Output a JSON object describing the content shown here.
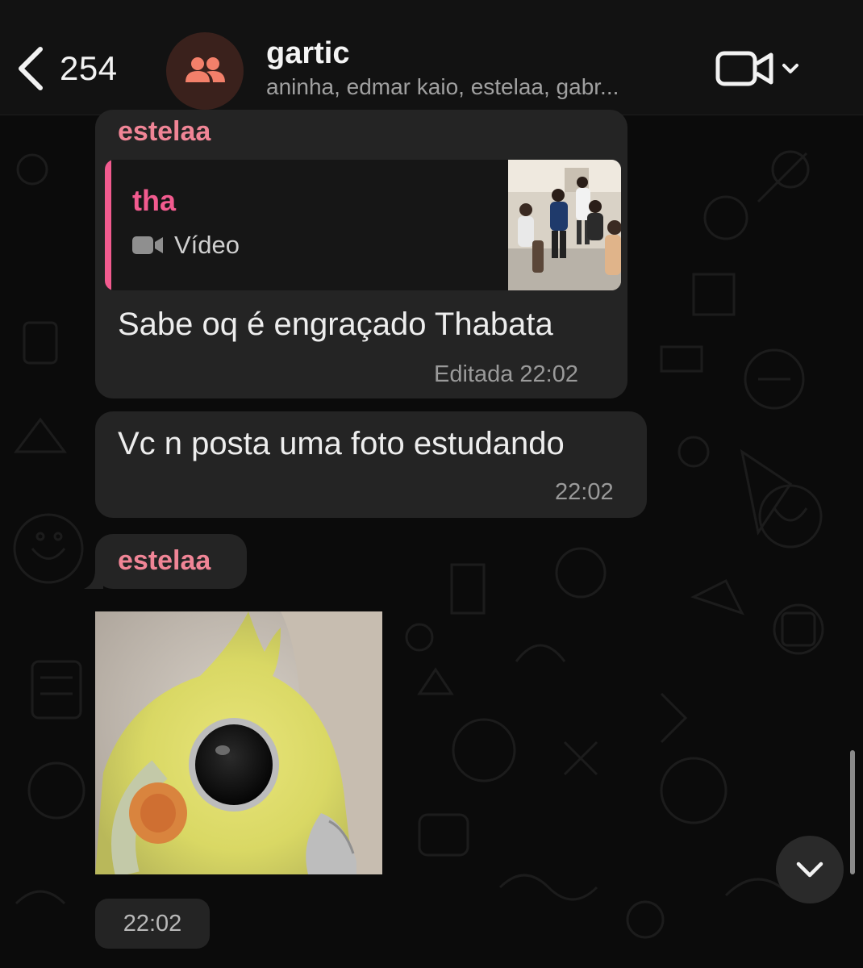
{
  "header": {
    "back_count": "254",
    "group_name": "gartic",
    "members": "aninha, edmar kaio, estelaa, gabr...",
    "avatar_icon": "group-icon",
    "call_icon": "video-camera-icon"
  },
  "messages": [
    {
      "sender": "estelaa",
      "reply_to": {
        "name": "tha",
        "media_label": "Vídeo",
        "media_icon": "video-camera-icon"
      },
      "text": "Sabe oq é engraçado Thabata",
      "meta": "Editada 22:02"
    },
    {
      "text": "Vc n posta uma foto estudando",
      "meta": "22:02"
    },
    {
      "sender": "estelaa",
      "media": "photo",
      "meta": "22:02"
    }
  ],
  "colors": {
    "sender_name": "#f08596",
    "quote_accent": "#f25b8f",
    "bubble": "#242424",
    "background": "#0b0b0b",
    "avatar_bg": "#3a211c",
    "avatar_icon": "#f3806a"
  }
}
